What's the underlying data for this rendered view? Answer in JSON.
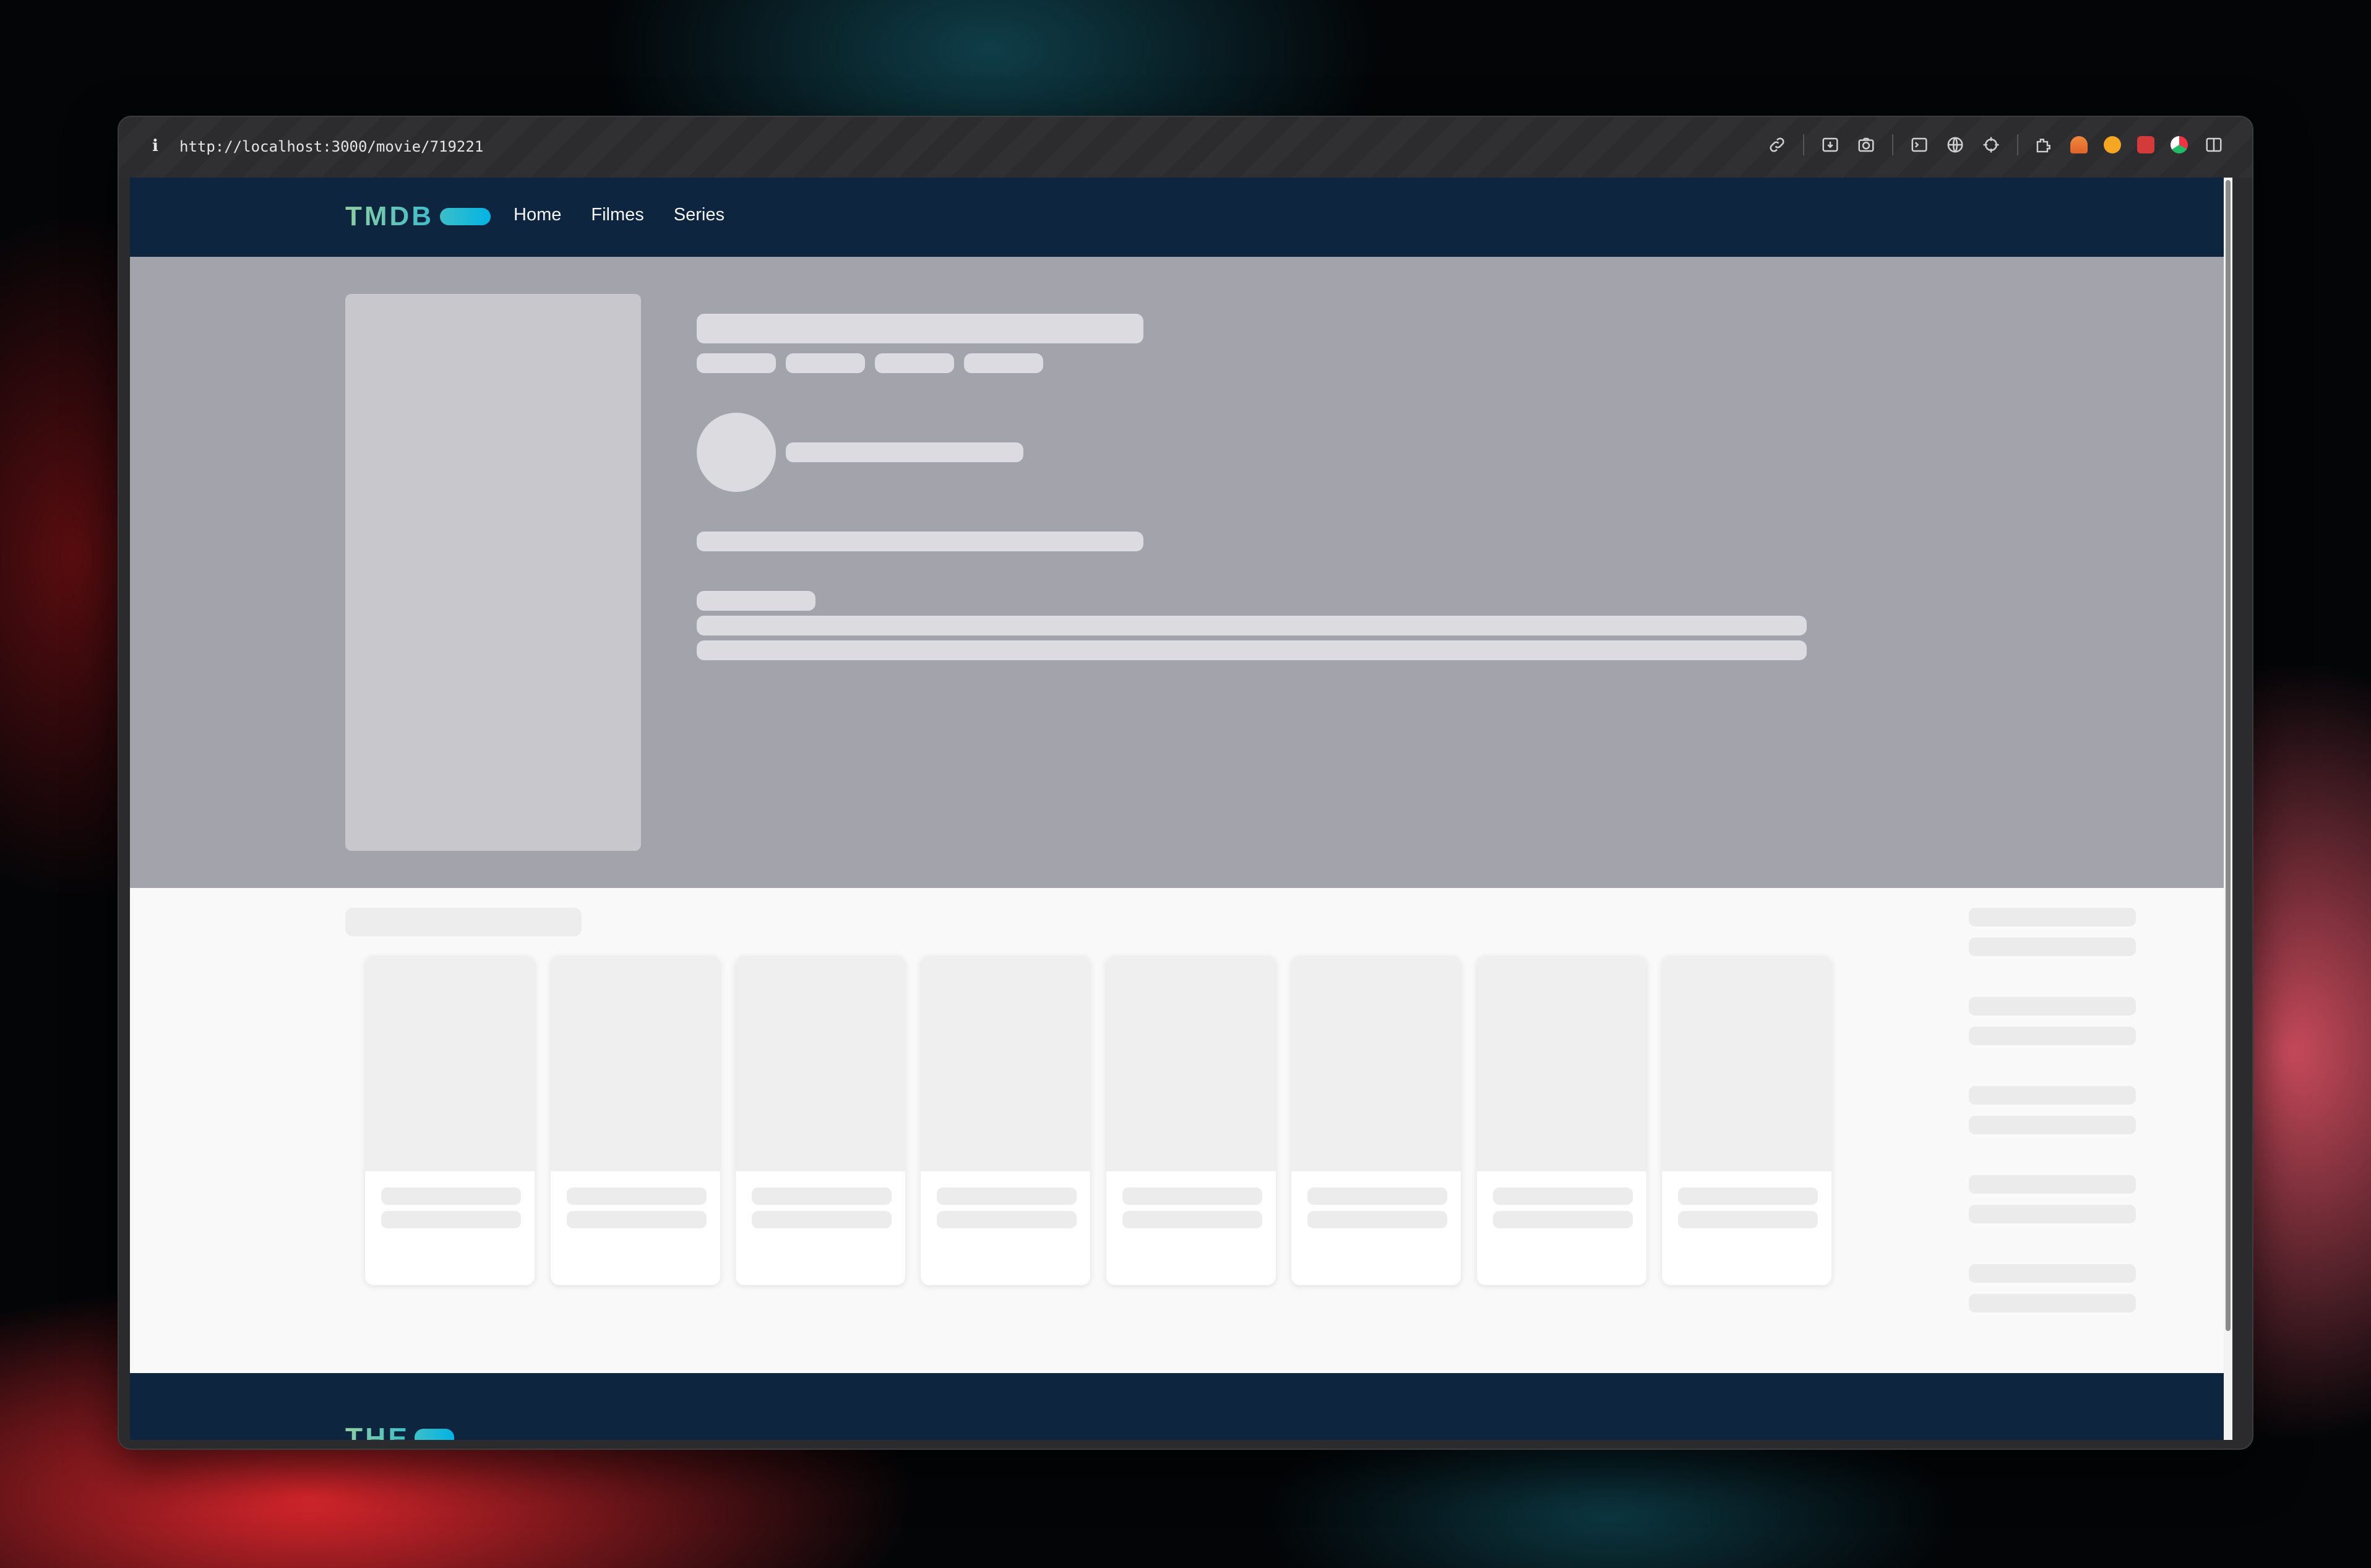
{
  "browser": {
    "url": "http://localhost:3000/movie/719221",
    "info_icon": "i",
    "toolbar_icons": [
      "link-icon",
      "download-icon",
      "camera-icon",
      "terminal-icon",
      "globe-icon",
      "crosshair-icon",
      "extensions-icon",
      "extension-orange-icon",
      "extension-yellow-icon",
      "extension-red-icon",
      "extension-color-icon",
      "sidebar-icon"
    ]
  },
  "navbar": {
    "logo_text": "TMDB",
    "links": [
      "Home",
      "Filmes",
      "Series"
    ]
  },
  "footer": {
    "logo_text": "THE"
  },
  "colors": {
    "navbar": "#0d253f",
    "hero_skeleton": "#a3a3ab",
    "logo_gradient_start": "#90cea1",
    "logo_gradient_end": "#01b4e4"
  }
}
